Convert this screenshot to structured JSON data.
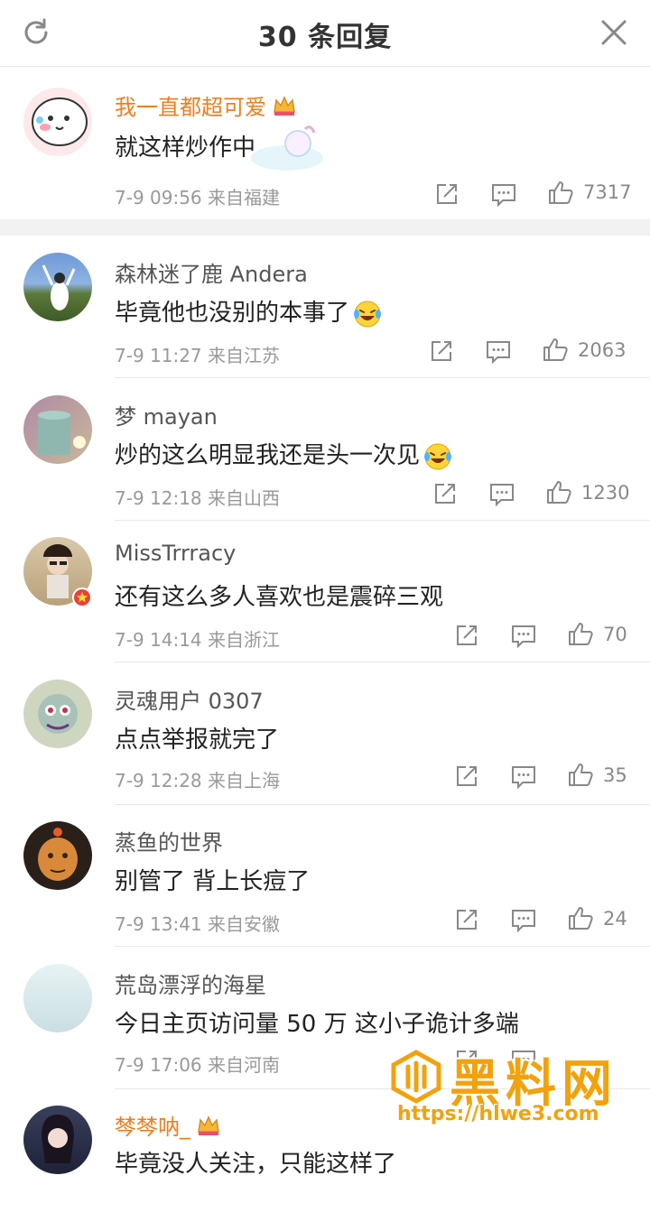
{
  "header": {
    "title": "30 条回复",
    "refresh_icon": "refresh-icon",
    "close_icon": "close-icon"
  },
  "main_comment": {
    "username": "我一直都超可爱",
    "content": "就这样炒作中",
    "meta": "7-9 09:56  来自福建",
    "likes": "7317",
    "badge": "crown-icon"
  },
  "replies": [
    {
      "username": "森林迷了鹿 Andera",
      "content": "毕竟他也没别的本事了",
      "emoji": "laugh-cry-emoji",
      "meta": "7-9 11:27  来自江苏",
      "likes": "2063"
    },
    {
      "username": "梦 mayan",
      "content": "炒的这么明显我还是头一次见",
      "emoji": "laugh-cry-emoji",
      "meta": "7-9 12:18  来自山西",
      "likes": "1230"
    },
    {
      "username": "MissTrrracy",
      "content": "还有这么多人喜欢也是震碎三观",
      "meta": "7-9 14:14  来自浙江",
      "likes": "70"
    },
    {
      "username": "灵魂用户 0307",
      "content": "点点举报就完了",
      "meta": "7-9 12:28  来自上海",
      "likes": "35"
    },
    {
      "username": "蒸鱼的世界",
      "content": "别管了 背上长痘了",
      "meta": "7-9 13:41  来自安徽",
      "likes": "24"
    },
    {
      "username": "荒岛漂浮的海星",
      "content": "今日主页访问量 50 万   这小子诡计多端",
      "meta": "7-9 17:06  来自河南",
      "likes": ""
    },
    {
      "username": "棽棽呐_",
      "content": "毕竟没人关注，只能这样了",
      "meta": "",
      "likes": ""
    }
  ],
  "watermark": {
    "text": "黑料网",
    "url": "https://hlwe3.com"
  },
  "colors": {
    "accent_orange": "#f07d1c",
    "watermark": "#f2a20c",
    "separator": "#f2f2f2"
  }
}
